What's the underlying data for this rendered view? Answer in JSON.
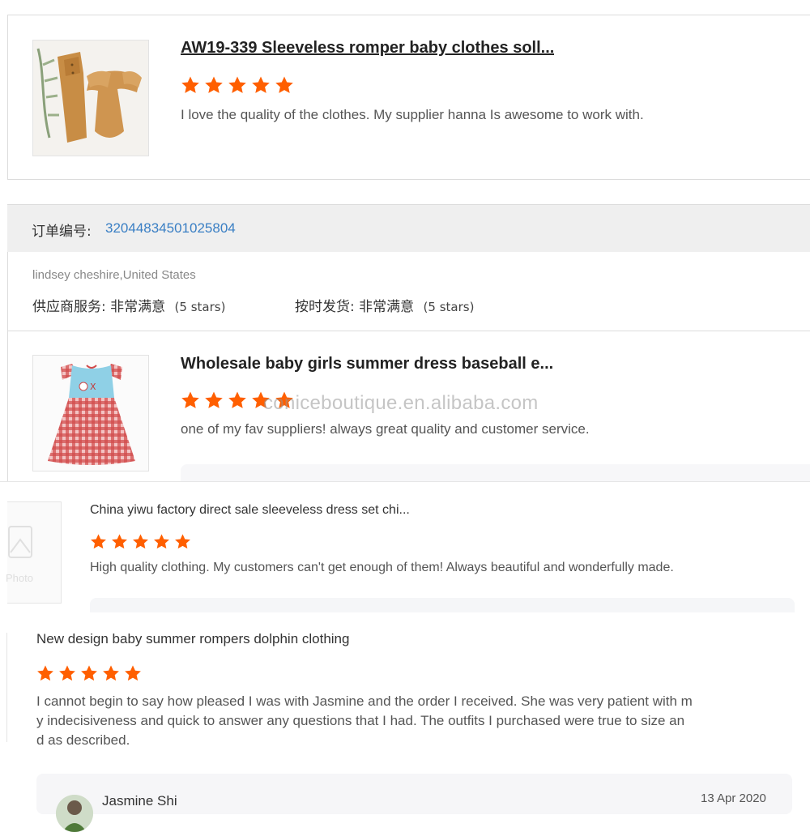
{
  "colors": {
    "star": "#ff5f00",
    "link": "#3a7fc4",
    "order_bar": "#f0f0f0"
  },
  "review1": {
    "product_title": "AW19-339 Sleeveless romper baby clothes soll...",
    "rating": 5,
    "text": "I love the quality of the clothes. My supplier hanna Is awesome to work with.",
    "image_icon": "romper-photo"
  },
  "order": {
    "label": "订单编号:",
    "number": "32044834501025804",
    "buyer": "lindsey cheshire,United States",
    "service_label": "供应商服务:",
    "service_value": "非常满意",
    "service_stars": "(5 stars)",
    "ship_label": "按时发货:",
    "ship_value": "非常满意",
    "ship_stars": "(5 stars)"
  },
  "review2": {
    "product_title": "Wholesale baby girls summer dress baseball e...",
    "rating": 5,
    "text": "one of my fav suppliers! always great quality and customer service.",
    "image_icon": "gingham-dress-photo"
  },
  "watermark": "coniceboutique.en.alibaba.com",
  "review3": {
    "product_title": "China yiwu factory direct sale sleeveless dress set chi...",
    "rating": 5,
    "text": "High quality clothing. My customers can't get enough of them! Always beautiful and wonderfully made.",
    "placeholder_label": "Photo"
  },
  "review4": {
    "product_title": "New design baby summer rompers dolphin clothing",
    "rating": 5,
    "text_lines": [
      "I cannot begin to say how pleased I was with Jasmine and the order I received. She was very patient with m",
      "y indecisiveness and quick to answer any questions that I had. The outfits I purchased were true to size an",
      "d as described."
    ],
    "reply_name": "Jasmine Shi",
    "reply_date": "13 Apr 2020"
  }
}
